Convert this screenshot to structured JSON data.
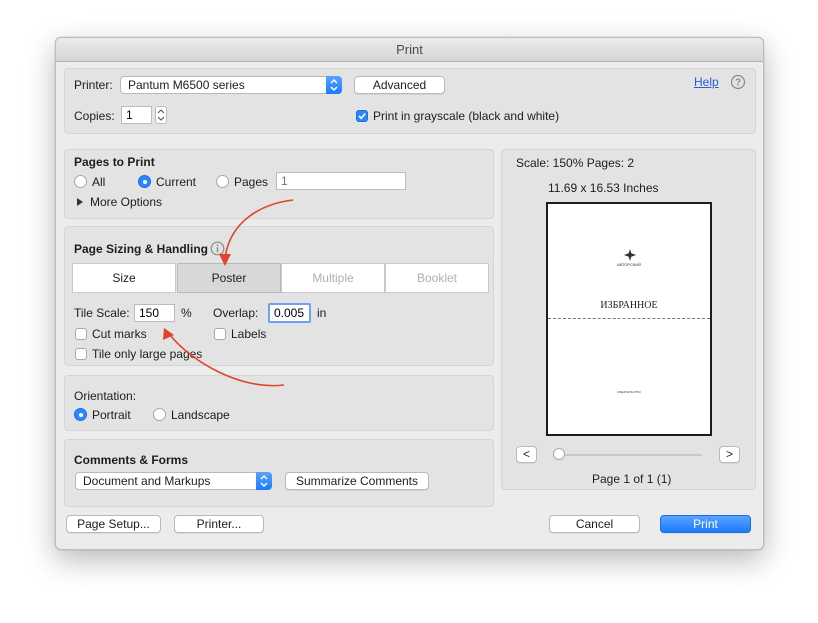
{
  "window": {
    "title": "Print"
  },
  "printer": {
    "label": "Printer:",
    "selected": "Pantum M6500 series",
    "advanced_label": "Advanced",
    "help_label": "Help",
    "copies_label": "Copies:",
    "copies_value": "1",
    "grayscale_label": "Print in grayscale (black and white)",
    "grayscale_checked": true
  },
  "pages_to_print": {
    "title": "Pages to Print",
    "all_label": "All",
    "current_label": "Current",
    "pages_label": "Pages",
    "pages_placeholder": "1",
    "selected": "Current",
    "more_options_label": "More Options"
  },
  "page_sizing": {
    "title": "Page Sizing & Handling",
    "tabs": [
      {
        "label": "Size",
        "state": "normal"
      },
      {
        "label": "Poster",
        "state": "active"
      },
      {
        "label": "Multiple",
        "state": "disabled"
      },
      {
        "label": "Booklet",
        "state": "disabled"
      }
    ],
    "tile_scale_label": "Tile Scale:",
    "tile_scale_value": "150",
    "tile_scale_unit": "%",
    "overlap_label": "Overlap:",
    "overlap_value": "0.005",
    "overlap_unit": "in",
    "cut_marks_label": "Cut marks",
    "labels_label": "Labels",
    "tile_only_large_label": "Tile only large pages"
  },
  "orientation": {
    "title": "Orientation:",
    "portrait_label": "Portrait",
    "landscape_label": "Landscape",
    "selected": "Portrait"
  },
  "comments_forms": {
    "title": "Comments & Forms",
    "selected": "Document and Markups",
    "summarize_label": "Summarize Comments"
  },
  "preview": {
    "scale_text": "Scale: 150% Pages: 2",
    "size_text": "11.69 x 16.53 Inches",
    "doc_publisher": "АВТОРСКИЙ",
    "doc_title": "ИЗБРАННОЕ",
    "doc_footer": "ИЗДАТЕЛЬСТВО",
    "prev_label": "<",
    "next_label": ">",
    "page_indicator": "Page 1 of 1 (1)"
  },
  "footer": {
    "page_setup_label": "Page Setup...",
    "printer_label": "Printer...",
    "cancel_label": "Cancel",
    "print_label": "Print"
  },
  "colors": {
    "accent": "#1a7bff",
    "annotation_arrow": "#e0442b"
  }
}
